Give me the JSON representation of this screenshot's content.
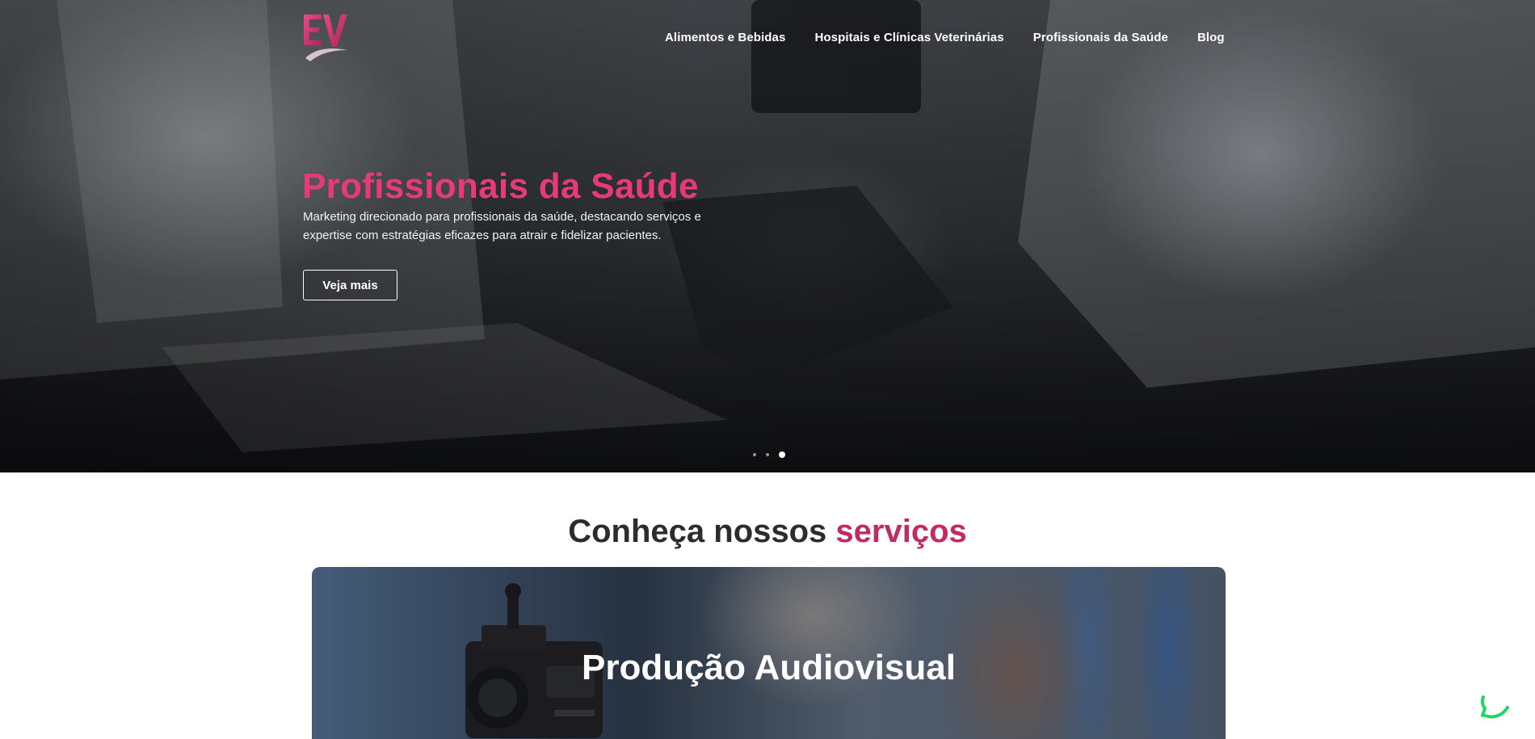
{
  "brand": {
    "logo_text": "EV"
  },
  "nav": {
    "items": [
      {
        "label": "Alimentos e Bebidas"
      },
      {
        "label": "Hospitais e Clínicas Veterinárias"
      },
      {
        "label": "Profissionais da Saúde"
      },
      {
        "label": "Blog"
      }
    ]
  },
  "hero": {
    "title": "Profissionais da Saúde",
    "description": "Marketing direcionado para profissionais da saúde, destacando serviços e expertise com estratégias eficazes para atrair e fidelizar pacientes.",
    "button_label": "Veja mais",
    "slides_total": 3,
    "active_slide": 3
  },
  "services": {
    "title_prefix": "Conheça nossos",
    "title_accent": "serviços",
    "cards": [
      {
        "title": "Produção Audiovisual"
      }
    ]
  },
  "colors": {
    "accent_pink": "#e83a7a",
    "accent_dark_pink": "#c22a63",
    "whatsapp_green": "#25d366"
  },
  "icons": {
    "whatsapp": "whatsapp-icon"
  }
}
